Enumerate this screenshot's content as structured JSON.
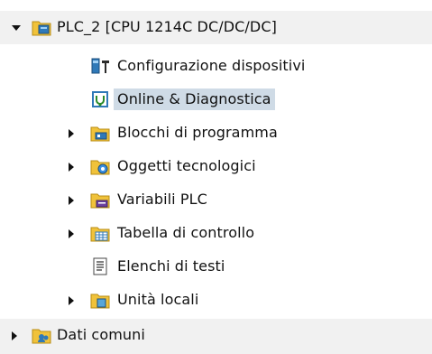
{
  "tree": {
    "plc": {
      "label": "PLC_2 [CPU 1214C DC/DC/DC]",
      "icon": "plc-folder-icon",
      "expanded": true
    },
    "items": [
      {
        "label": "Configurazione dispositivi",
        "icon": "device-config-icon"
      },
      {
        "label": "Online & Diagnostica",
        "icon": "online-diagnostics-icon",
        "selected": true
      },
      {
        "label": "Blocchi di programma",
        "icon": "program-blocks-folder-icon",
        "expandable": true
      },
      {
        "label": "Oggetti tecnologici",
        "icon": "technology-objects-folder-icon",
        "expandable": true
      },
      {
        "label": "Variabili PLC",
        "icon": "plc-tags-folder-icon",
        "expandable": true
      },
      {
        "label": "Tabella di controllo",
        "icon": "watch-table-folder-icon",
        "expandable": true
      },
      {
        "label": "Elenchi di testi",
        "icon": "text-lists-icon"
      },
      {
        "label": "Unità locali",
        "icon": "local-modules-folder-icon",
        "expandable": true
      }
    ],
    "common": {
      "label": "Dati comuni",
      "icon": "common-data-folder-icon",
      "expanded": false
    }
  },
  "colors": {
    "folder": "#f0c23a",
    "selection": "#cfdbe6",
    "band": "#f1f1f1"
  }
}
